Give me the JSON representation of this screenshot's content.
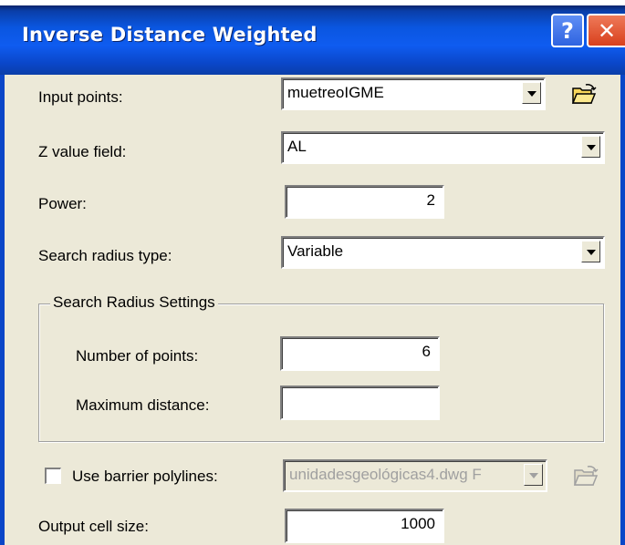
{
  "window": {
    "title": "Inverse Distance Weighted",
    "help_glyph": "?",
    "close_glyph": "✕"
  },
  "fields": {
    "input_points": {
      "label": "Input points:",
      "value": "muetreoIGME"
    },
    "z_value_field": {
      "label": "Z value field:",
      "value": "AL"
    },
    "power": {
      "label": "Power:",
      "value": "2"
    },
    "search_radius_type": {
      "label": "Search radius type:",
      "value": "Variable"
    },
    "search_radius_settings": {
      "legend": "Search Radius Settings",
      "number_of_points": {
        "label": "Number of points:",
        "value": "6"
      },
      "maximum_distance": {
        "label": "Maximum distance:",
        "value": ""
      }
    },
    "use_barrier_polylines": {
      "label": "Use barrier polylines:",
      "checked": false,
      "value": "unidadesgeológicas4.dwg F"
    },
    "output_cell_size": {
      "label": "Output cell size:",
      "value": "1000"
    }
  },
  "icons": {
    "open_folder": "open-folder-icon",
    "dropdown": "chevron-down-icon"
  }
}
